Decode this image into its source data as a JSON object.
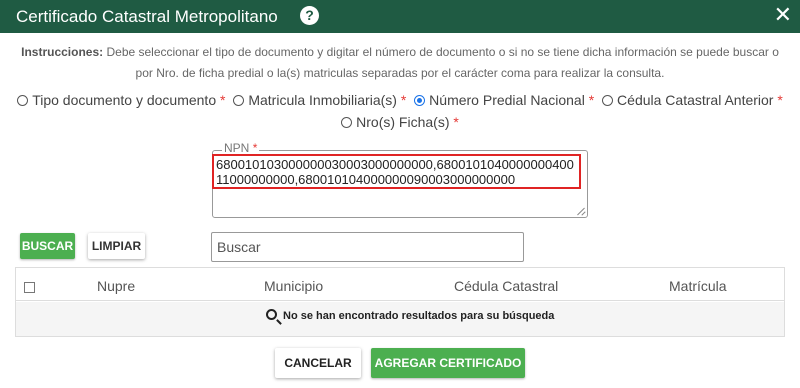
{
  "header": {
    "title": "Certificado Catastral Metropolitano",
    "help_symbol": "?",
    "close_symbol": "✕"
  },
  "instructions": {
    "label": "Instrucciones:",
    "line1": "Debe seleccionar el tipo de documento y digitar el número de documento o si no se tiene dicha información se puede buscar o",
    "line2": "por Nro. de ficha predial o la(s) matriculas separadas por el carácter coma para realizar la consulta."
  },
  "search_types": {
    "required_mark": "*",
    "selected": "Número Predial Nacional",
    "options": [
      {
        "label": "Tipo documento y documento"
      },
      {
        "label": "Matricula Inmobiliaria(s)"
      },
      {
        "label": "Número Predial Nacional"
      },
      {
        "label": "Cédula Catastral Anterior"
      },
      {
        "label": "Nro(s) Ficha(s)"
      }
    ]
  },
  "npn": {
    "label": "NPN",
    "required_mark": "*",
    "value": "680010103000000030003000000000,680010104000000040011000000000,680010104000000090003000000000"
  },
  "buttons": {
    "buscar": "BUSCAR",
    "limpiar": "LIMPIAR",
    "cancelar": "CANCELAR",
    "agregar": "AGREGAR CERTIFICADO"
  },
  "search_filter": {
    "placeholder": "Buscar"
  },
  "table": {
    "columns": [
      "Nupre",
      "Municipio",
      "Cédula Catastral",
      "Matrícula"
    ],
    "empty_message": "No se han encontrado resultados para su búsqueda",
    "rows": []
  },
  "colors": {
    "header_bg": "#1f5b43",
    "primary_button": "#4caf50",
    "highlight_border": "#e02424",
    "required": "#e53935",
    "radio_selected": "#1a73e8"
  }
}
